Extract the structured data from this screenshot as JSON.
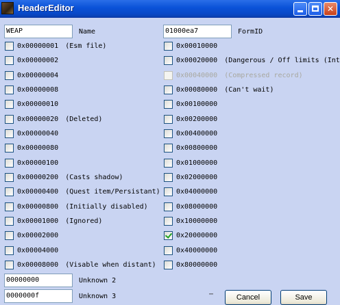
{
  "window": {
    "title": "HeaderEditor"
  },
  "top": {
    "type_value": "WEAP",
    "name_label": "Name",
    "formid_value": "01000ea7",
    "formid_label": "FormID"
  },
  "left_flags": [
    {
      "code": "0x00000001",
      "desc": "(Esm file)",
      "checked": false
    },
    {
      "code": "0x00000002",
      "desc": "",
      "checked": false
    },
    {
      "code": "0x00000004",
      "desc": "",
      "checked": false
    },
    {
      "code": "0x00000008",
      "desc": "",
      "checked": false
    },
    {
      "code": "0x00000010",
      "desc": "",
      "checked": false
    },
    {
      "code": "0x00000020",
      "desc": "(Deleted)",
      "checked": false
    },
    {
      "code": "0x00000040",
      "desc": "",
      "checked": false
    },
    {
      "code": "0x00000080",
      "desc": "",
      "checked": false
    },
    {
      "code": "0x00000100",
      "desc": "",
      "checked": false
    },
    {
      "code": "0x00000200",
      "desc": "(Casts shadow)",
      "checked": false
    },
    {
      "code": "0x00000400",
      "desc": "(Quest item/Persistant)",
      "checked": false
    },
    {
      "code": "0x00000800",
      "desc": "(Initially disabled)",
      "checked": false
    },
    {
      "code": "0x00001000",
      "desc": "(Ignored)",
      "checked": false
    },
    {
      "code": "0x00002000",
      "desc": "",
      "checked": false
    },
    {
      "code": "0x00004000",
      "desc": "",
      "checked": false
    },
    {
      "code": "0x00008000",
      "desc": "(Visable when distant)",
      "checked": false
    }
  ],
  "right_flags": [
    {
      "code": "0x00010000",
      "desc": "",
      "checked": false,
      "disabled": false
    },
    {
      "code": "0x00020000",
      "desc": "(Dangerous / Off limits (Inte",
      "checked": false,
      "disabled": false
    },
    {
      "code": "0x00040000",
      "desc": "(Compressed record)",
      "checked": false,
      "disabled": true
    },
    {
      "code": "0x00080000",
      "desc": "(Can't wait)",
      "checked": false,
      "disabled": false
    },
    {
      "code": "0x00100000",
      "desc": "",
      "checked": false,
      "disabled": false
    },
    {
      "code": "0x00200000",
      "desc": "",
      "checked": false,
      "disabled": false
    },
    {
      "code": "0x00400000",
      "desc": "",
      "checked": false,
      "disabled": false
    },
    {
      "code": "0x00800000",
      "desc": "",
      "checked": false,
      "disabled": false
    },
    {
      "code": "0x01000000",
      "desc": "",
      "checked": false,
      "disabled": false
    },
    {
      "code": "0x02000000",
      "desc": "",
      "checked": false,
      "disabled": false
    },
    {
      "code": "0x04000000",
      "desc": "",
      "checked": false,
      "disabled": false
    },
    {
      "code": "0x08000000",
      "desc": "",
      "checked": false,
      "disabled": false
    },
    {
      "code": "0x10000000",
      "desc": "",
      "checked": false,
      "disabled": false
    },
    {
      "code": "0x20000000",
      "desc": "",
      "checked": true,
      "disabled": false
    },
    {
      "code": "0x40000000",
      "desc": "",
      "checked": false,
      "disabled": false
    },
    {
      "code": "0x80000000",
      "desc": "",
      "checked": false,
      "disabled": false
    }
  ],
  "bottom": {
    "unknown2_value": "00000000",
    "unknown2_label": "Unknown 2",
    "unknown3_value": "0000000f",
    "unknown3_label": "Unknown 3",
    "cancel_label": "Cancel",
    "save_label": "Save"
  },
  "colors": {
    "background": "#c9d4f2",
    "titlebar": "#0a52d8",
    "checkmark": "#21a121"
  }
}
